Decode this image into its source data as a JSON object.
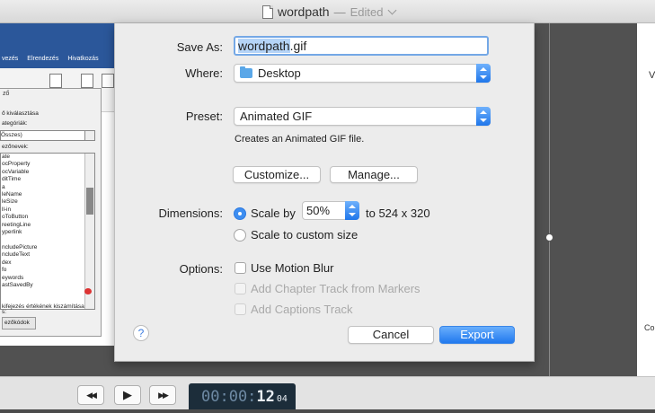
{
  "window": {
    "title": "wordpath",
    "separator": "—",
    "status": "Edited"
  },
  "background_video": {
    "ribbon_tabs": [
      "vezés",
      "Elrendezés",
      "Hivatkozás"
    ],
    "dialog_title": "ző",
    "category_label": "ő kiválasztása",
    "categories_label": "ategóriák:",
    "category_value": "Összes)",
    "field_names_label": "ezőnevek:",
    "field_list": [
      "ate",
      "ocProperty",
      "ocVariable",
      "ditTime",
      "a",
      "leName",
      "leSize",
      "ll-in",
      "oToButton",
      "reetingLine",
      "yperlink",
      "",
      "ncludePicture",
      "ncludeText",
      "dex",
      "fo",
      "eywords",
      "astSavedBy"
    ],
    "extra_label": "s:",
    "description": "kifejezés értékének kiszámítása",
    "codes_button": "ezőkódok",
    "right_label_v": "V",
    "right_label_co": "Co"
  },
  "export_dialog": {
    "save_as_label": "Save As:",
    "filename_base": "wordpath",
    "filename_ext": ".gif",
    "where_label": "Where:",
    "where_value": "Desktop",
    "preset_label": "Preset:",
    "preset_value": "Animated GIF",
    "preset_description": "Creates an Animated GIF file.",
    "customize_button": "Customize...",
    "manage_button": "Manage...",
    "dimensions_label": "Dimensions:",
    "scale_by_label": "Scale by",
    "scale_value": "50%",
    "scale_result": "to 524 x 320",
    "scale_custom_label": "Scale to custom size",
    "options_label": "Options:",
    "motion_blur_label": "Use Motion Blur",
    "chapter_track_label": "Add Chapter Track from Markers",
    "captions_track_label": "Add Captions Track",
    "help_symbol": "?",
    "cancel_button": "Cancel",
    "export_button": "Export"
  },
  "transport": {
    "rewind_symbol": "◀◀",
    "play_symbol": "▶",
    "forward_symbol": "▶▶",
    "timecode_prefix": "00:00:",
    "timecode_seconds": "12",
    "timecode_frames": "04"
  },
  "icons": [
    "document-icon",
    "folder-icon",
    "rewind-icon",
    "play-icon",
    "fast-forward-icon",
    "help-icon"
  ],
  "colors": {
    "accent": "#2179ee",
    "selection": "#b5d4f7",
    "timecode_bg": "#1c2d3a"
  }
}
